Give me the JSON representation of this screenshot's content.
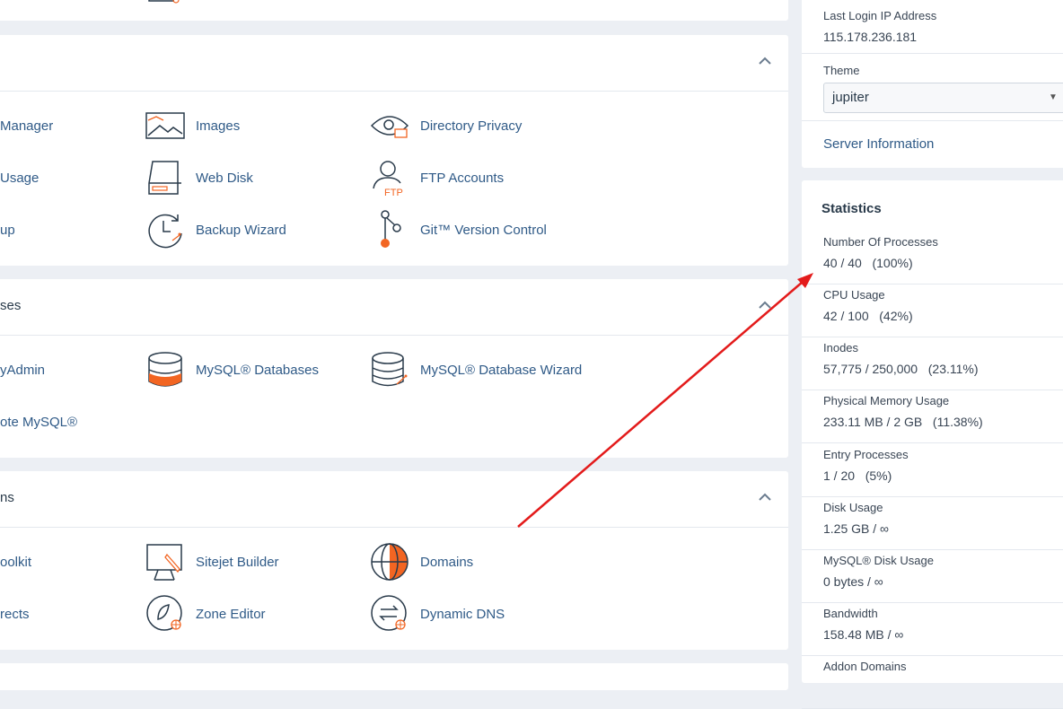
{
  "files": {
    "items": [
      {
        "label": "Manager",
        "cut": true
      },
      {
        "label": "Images"
      },
      {
        "label": "Directory Privacy"
      },
      {
        "label": "Usage",
        "cut": true
      },
      {
        "label": "Web Disk"
      },
      {
        "label": "FTP Accounts"
      },
      {
        "label": "up",
        "cut": true
      },
      {
        "label": "Backup Wizard"
      },
      {
        "label": "Git™ Version Control"
      }
    ]
  },
  "databases": {
    "title_cut": "ses",
    "items": [
      {
        "label": "yAdmin",
        "cut": true
      },
      {
        "label": "MySQL® Databases"
      },
      {
        "label": "MySQL® Database Wizard"
      },
      {
        "label": "ote MySQL®",
        "cut": true
      }
    ]
  },
  "domains": {
    "title_cut": "ns",
    "items": [
      {
        "label": "oolkit",
        "cut": true
      },
      {
        "label": "Sitejet Builder"
      },
      {
        "label": "Domains"
      },
      {
        "label": "rects",
        "cut": true
      },
      {
        "label": "Zone Editor"
      },
      {
        "label": "Dynamic DNS"
      }
    ]
  },
  "general_info": {
    "last_login_label": "Last Login IP Address",
    "last_login_value": "115.178.236.181",
    "theme_label": "Theme",
    "theme_value": "jupiter",
    "server_info_link": "Server Information"
  },
  "statistics": {
    "title": "Statistics",
    "rows": [
      {
        "label": "Number Of Processes",
        "value": "40 / 40   (100%)"
      },
      {
        "label": "CPU Usage",
        "value": "42 / 100   (42%)"
      },
      {
        "label": "Inodes",
        "value": "57,775 / 250,000   (23.11%)"
      },
      {
        "label": "Physical Memory Usage",
        "value": "233.11 MB / 2 GB   (11.38%)"
      },
      {
        "label": "Entry Processes",
        "value": "1 / 20   (5%)"
      },
      {
        "label": "Disk Usage",
        "value": "1.25 GB / ∞"
      },
      {
        "label": "MySQL® Disk Usage",
        "value": "0 bytes / ∞"
      },
      {
        "label": "Bandwidth",
        "value": "158.48 MB / ∞"
      },
      {
        "label": "Addon Domains",
        "value": ""
      }
    ]
  },
  "colors": {
    "accent_orange": "#f26522",
    "link_blue": "#2f5a87",
    "annotation_red": "#e31b1b"
  }
}
